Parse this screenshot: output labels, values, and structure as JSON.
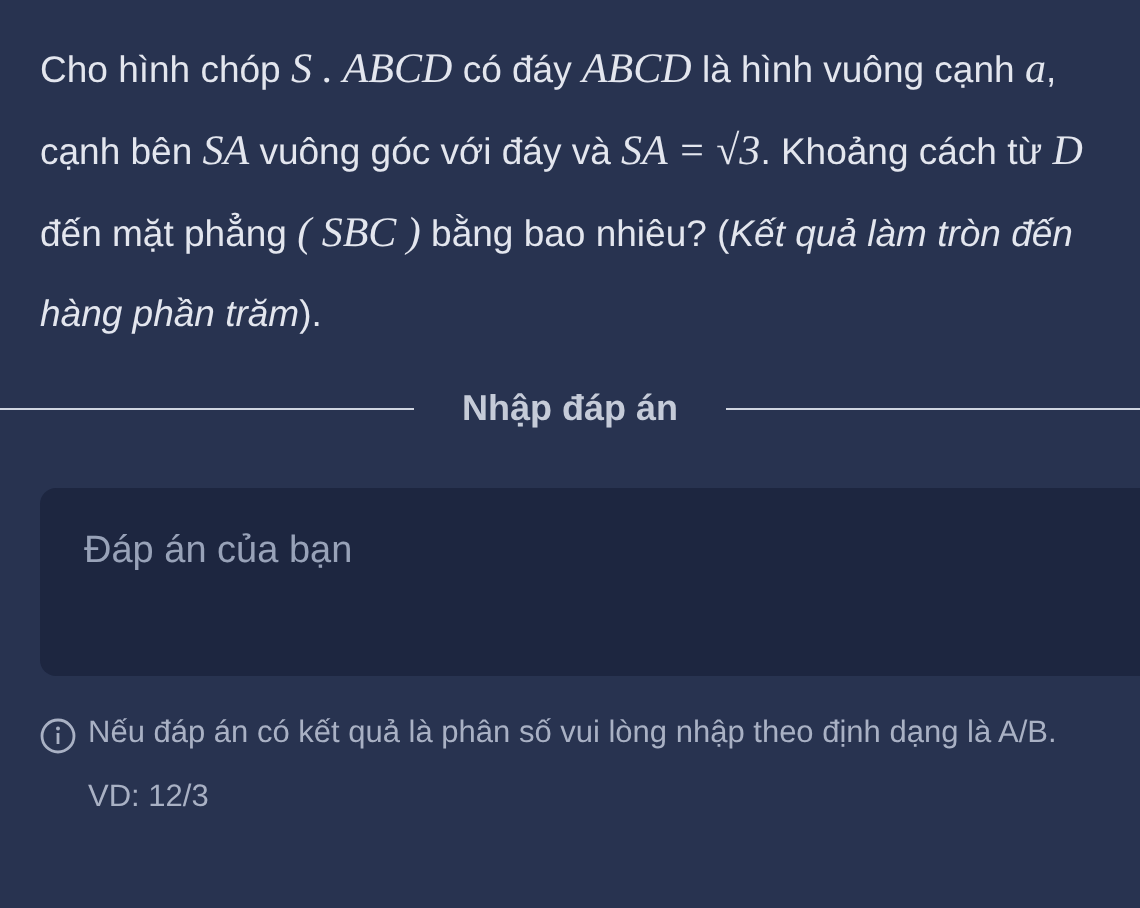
{
  "question": [
    {
      "kind": "text",
      "text": "Cho hình chóp "
    },
    {
      "kind": "math",
      "text": "S . ABCD"
    },
    {
      "kind": "text",
      "text": " có đáy "
    },
    {
      "kind": "math",
      "text": "ABCD"
    },
    {
      "kind": "text",
      "text": " là hình vuông cạnh "
    },
    {
      "kind": "math",
      "text": "a"
    },
    {
      "kind": "text",
      "text": ", cạnh bên "
    },
    {
      "kind": "math",
      "text": "SA"
    },
    {
      "kind": "text",
      "text": " vuông góc với đáy và "
    },
    {
      "kind": "math",
      "text": "SA = √3"
    },
    {
      "kind": "text",
      "text": ". Khoảng cách từ "
    },
    {
      "kind": "math",
      "text": "D"
    },
    {
      "kind": "text",
      "text": " đến mặt phẳng "
    },
    {
      "kind": "math",
      "text": "( SBC )"
    },
    {
      "kind": "text",
      "text": " bằng bao nhiêu? (*Kết quả làm tròn đến hàng phần trăm*)."
    }
  ],
  "divider_label": "Nhập đáp án",
  "answer": {
    "placeholder": "Đáp án của bạn"
  },
  "hint": "Nếu đáp án có kết quả là phân số vui lòng nhập theo định dạng là A/B. VD: 12/3"
}
